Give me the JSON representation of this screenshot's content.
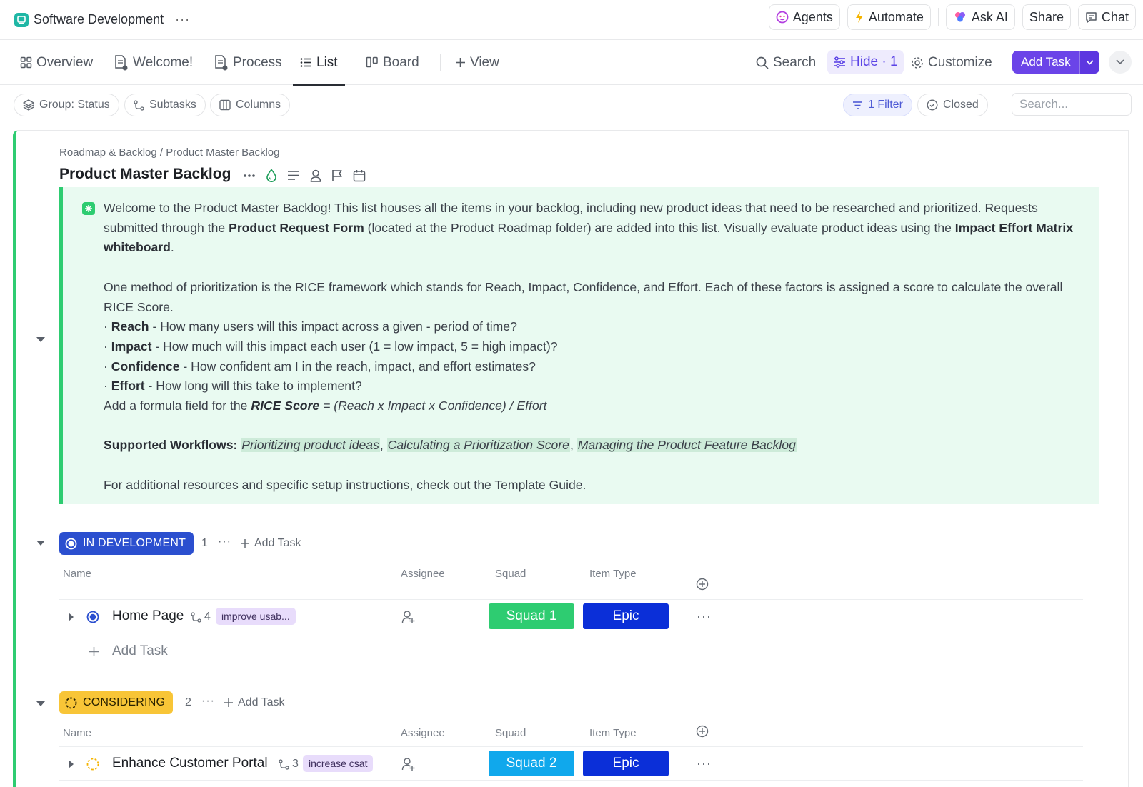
{
  "workspace": {
    "title": "Software Development",
    "more": "···"
  },
  "top_actions": {
    "agents": "Agents",
    "automate": "Automate",
    "ask_ai": "Ask AI",
    "share": "Share",
    "chat": "Chat"
  },
  "tabs": [
    {
      "label": "Overview"
    },
    {
      "label": "Welcome!"
    },
    {
      "label": "Process"
    },
    {
      "label": "List"
    },
    {
      "label": "Board"
    },
    {
      "label": "View"
    }
  ],
  "toolbar": {
    "search": "Search",
    "hide": "Hide · 1",
    "customize": "Customize",
    "add_task": "Add Task"
  },
  "filters": {
    "group": "Group: Status",
    "subtasks": "Subtasks",
    "columns": "Columns",
    "filter": "1 Filter",
    "closed": "Closed",
    "search_placeholder": "Search..."
  },
  "breadcrumb": "Roadmap & Backlog / Product Master Backlog",
  "page_title": "Product Master Backlog",
  "description": {
    "p1_a": "Welcome to the Product Master Backlog! This list houses all the items in your backlog, including new product ideas that need to be researched and prioritized. Requests submitted through the ",
    "p1_b": "Product Request Form",
    "p1_c": " (located at the Product Roadmap folder) are added into this list. Visually evaluate product ideas using the ",
    "p1_d": "Impact Effort Matrix whiteboard",
    "p1_e": ".",
    "p2": "One method of prioritization is the RICE framework which stands for Reach, Impact, Confidence, and Effort. Each of these factors is assigned a score to calculate the overall RICE Score.",
    "bullets": [
      {
        "term": "Reach",
        "text": " - How many users will this impact across a given - period of time?"
      },
      {
        "term": "Impact",
        "text": " - How much will this impact each user (1 = low impact, 5 = high impact)?"
      },
      {
        "term": "Confidence",
        "text": " - How confident am I in the reach, impact, and effort estimates?"
      },
      {
        "term": "Effort",
        "text": " - How long will this take to implement?"
      }
    ],
    "formula_a": "Add a formula field for the ",
    "formula_b": "RICE Score",
    "formula_c": " = (Reach x Impact x Confidence) / Effort",
    "workflows_label": "Supported Workflows:",
    "workflows": [
      "Prioritizing product ideas",
      "Calculating a Prioritization Score",
      "Managing the Product Feature Backlog"
    ],
    "footer": "For additional resources and specific setup instructions, check out the Template Guide."
  },
  "columns": {
    "name": "Name",
    "assignee": "Assignee",
    "squad": "Squad",
    "item_type": "Item Type"
  },
  "groups": [
    {
      "status": "IN DEVELOPMENT",
      "count": "1",
      "add_task": "Add Task",
      "color": "#2b4fcf",
      "tasks": [
        {
          "name": "Home Page",
          "subtasks": "4",
          "tag": "improve usab...",
          "squad": "Squad 1",
          "squad_color": "#2ecc71",
          "item_type": "Epic",
          "type_color": "#0b2fd8"
        }
      ],
      "add_row": "Add Task"
    },
    {
      "status": "CONSIDERING",
      "count": "2",
      "add_task": "Add Task",
      "color": "#f8c537",
      "tasks": [
        {
          "name": "Enhance Customer Portal",
          "subtasks": "3",
          "tag": "increase csat",
          "squad": "Squad 2",
          "squad_color": "#10a8ec",
          "item_type": "Epic",
          "type_color": "#0b2fd8"
        }
      ]
    }
  ]
}
